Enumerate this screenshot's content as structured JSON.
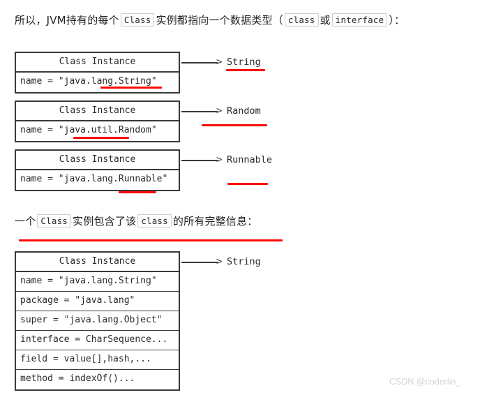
{
  "page": {
    "background_color": "#ffffff",
    "annotation_color": "#fb0a0a",
    "box_border_color": "#3a3a3a",
    "watermark": "CSDN @coderlin_"
  },
  "intro_line": {
    "seg1": "所以，JVM持有的每个",
    "chip1": "Class",
    "seg2": "实例都指向一个数据类型（",
    "chip2": "class",
    "seg3": "或",
    "chip3": "interface",
    "seg4": "）："
  },
  "mid_line": {
    "seg1": "一个",
    "chip1": "Class",
    "seg2": "实例包含了该",
    "chip2": "class",
    "seg3": "的所有完整信息："
  },
  "diagrams": [
    {
      "header": "Class Instance",
      "rows": [
        "name = \"java.lang.String\""
      ],
      "arrow_head": ">",
      "target": "String"
    },
    {
      "header": "Class Instance",
      "rows": [
        "name = \"java.util.Random\""
      ],
      "arrow_head": ">",
      "target": "Random"
    },
    {
      "header": "Class Instance",
      "rows": [
        "name = \"java.lang.Runnable\""
      ],
      "arrow_head": ">",
      "target": "Runnable"
    }
  ],
  "detail_diagram": {
    "header": "Class Instance",
    "rows": [
      "name = \"java.lang.String\"",
      "package = \"java.lang\"",
      "super = \"java.lang.Object\"",
      "interface = CharSequence...",
      "field = value[],hash,...",
      "method = indexOf()..."
    ],
    "arrow_head": ">",
    "target": "String"
  }
}
